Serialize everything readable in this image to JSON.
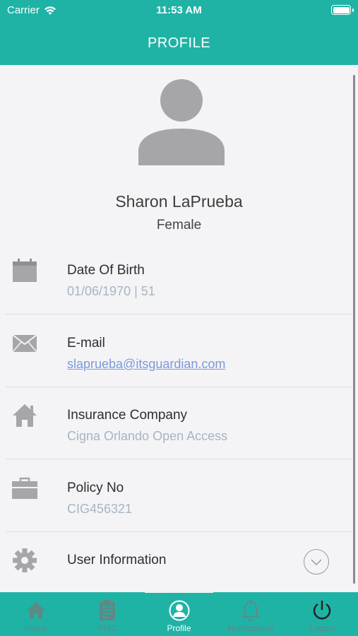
{
  "status_bar": {
    "carrier": "Carrier",
    "time": "11:53 AM"
  },
  "header": {
    "title": "PROFILE"
  },
  "profile": {
    "name": "Sharon LaPrueba",
    "gender": "Female"
  },
  "rows": [
    {
      "label": "Date Of Birth",
      "value": "01/06/1970 | 51",
      "icon": "calendar-icon"
    },
    {
      "label": "E-mail",
      "value": "slaprueba@itsguardian.com",
      "icon": "envelope-icon"
    },
    {
      "label": "Insurance Company",
      "value": "Cigna Orlando Open Access",
      "icon": "home-icon"
    },
    {
      "label": "Policy No",
      "value": "CIG456321",
      "icon": "briefcase-icon"
    },
    {
      "label": "User Information",
      "icon": "gear-icon"
    }
  ],
  "tabs": [
    {
      "label": "Home",
      "icon": "home-icon"
    },
    {
      "label": "PMC",
      "icon": "clipboard-icon"
    },
    {
      "label": "Profile",
      "icon": "profile-icon",
      "active": true
    },
    {
      "label": "Notifications",
      "icon": "bell-icon"
    },
    {
      "label": "Logout",
      "icon": "power-icon"
    }
  ],
  "colors": {
    "brand": "#1fb3a6",
    "icon_gray": "#a6a6a8",
    "link": "#7b9ad9",
    "value_gray": "#a8b4c4"
  }
}
